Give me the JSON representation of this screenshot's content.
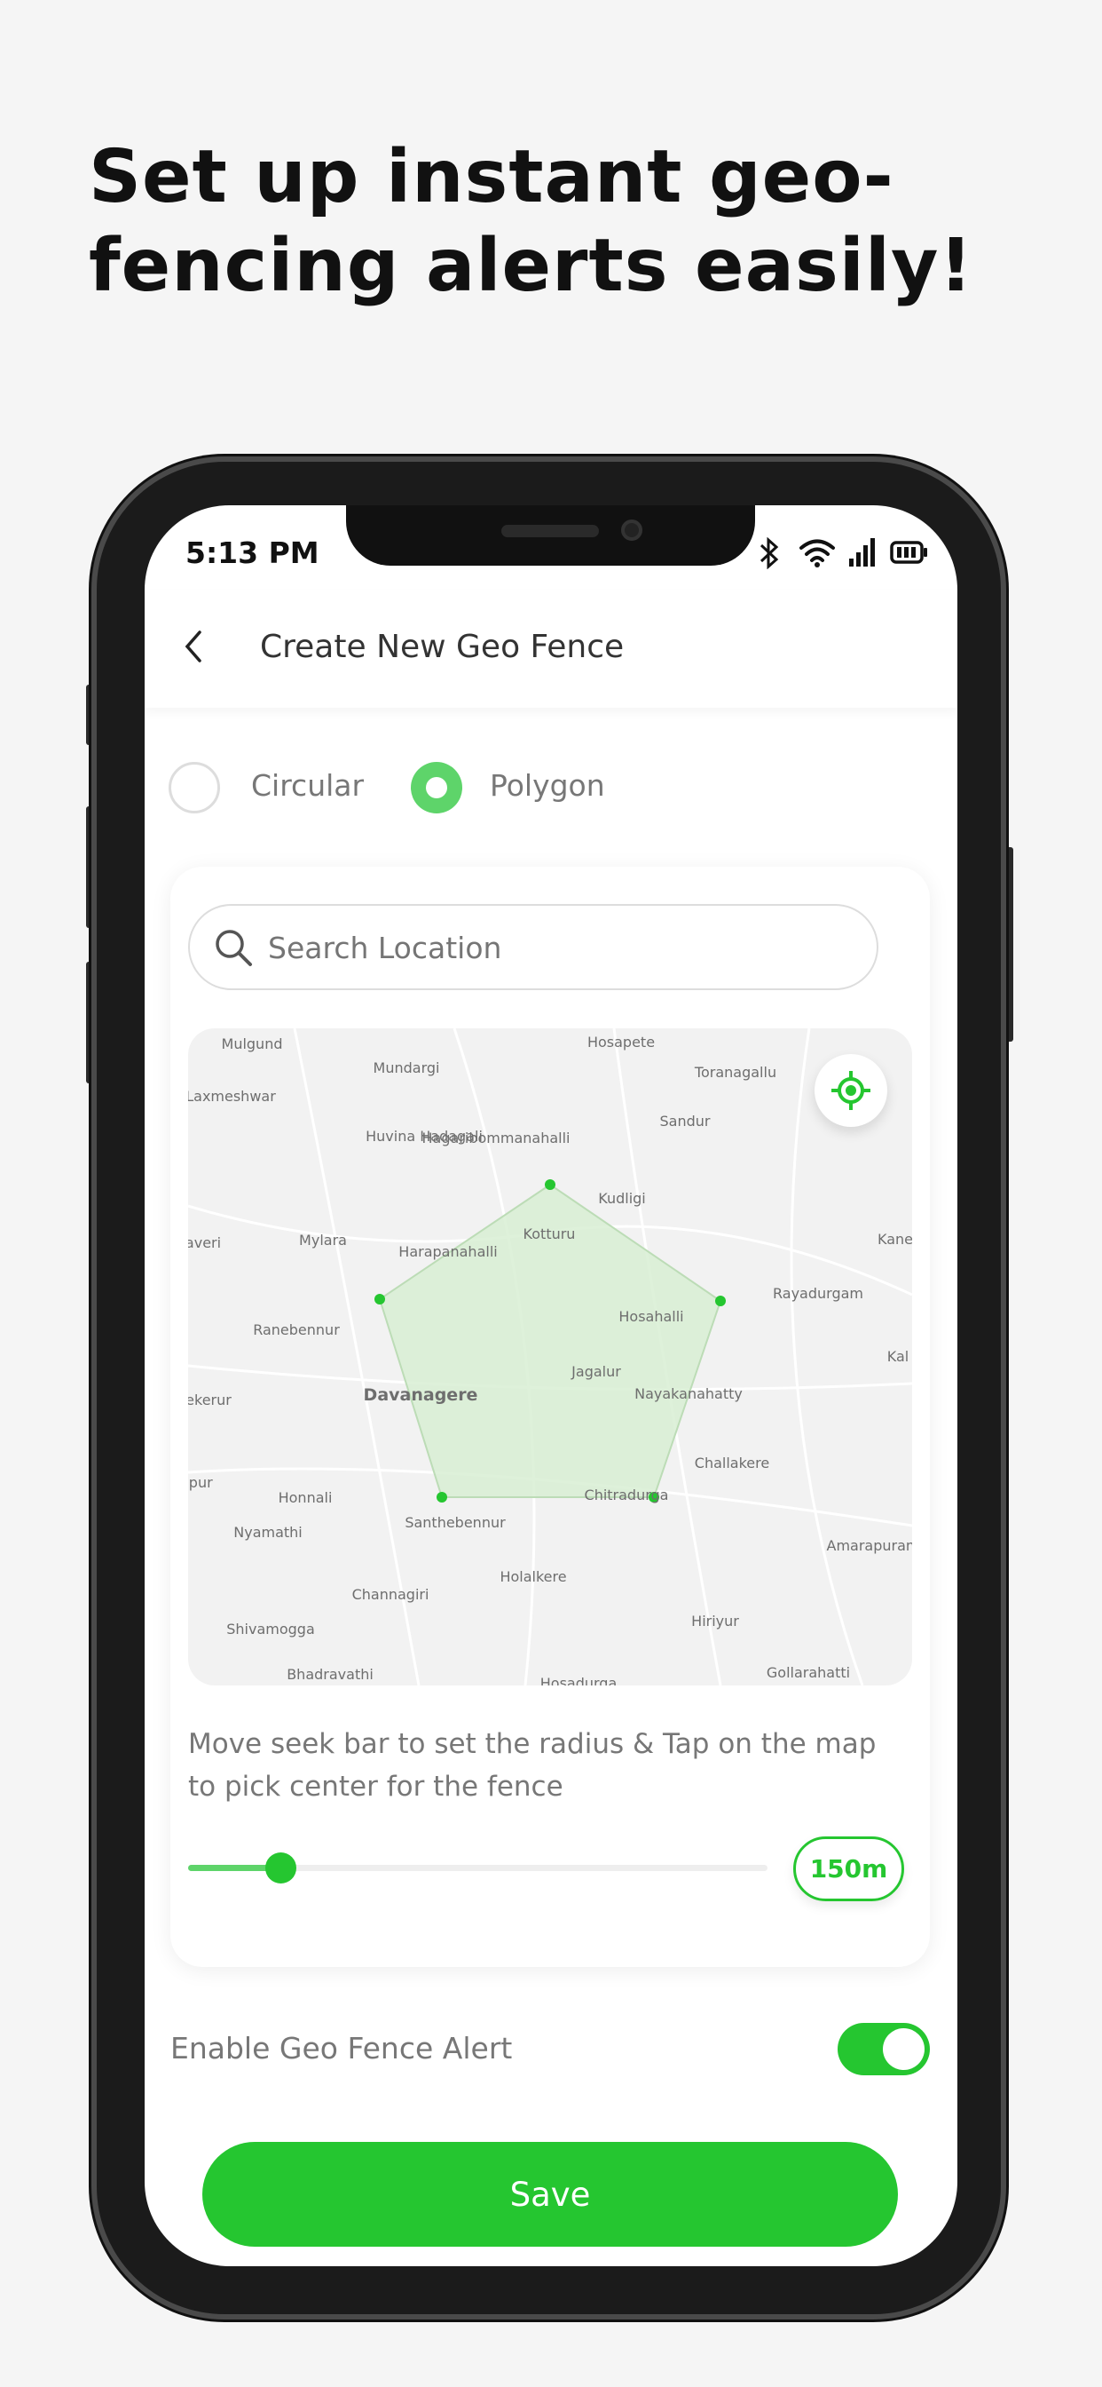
{
  "headline": "Set up instant geo-fencing alerts easily!",
  "status_bar": {
    "time": "5:13 PM",
    "icons": [
      "bluetooth-icon",
      "wifi-icon",
      "signal-icon",
      "battery-icon"
    ]
  },
  "header": {
    "title": "Create New Geo Fence",
    "back_icon": "chevron-left-icon"
  },
  "fence_type": {
    "options": [
      {
        "label": "Circular",
        "selected": false
      },
      {
        "label": "Polygon",
        "selected": true
      }
    ]
  },
  "search": {
    "placeholder": "Search Location",
    "value": ""
  },
  "map": {
    "labels": [
      "Mulgund",
      "Hosapete",
      "Mundargi",
      "Toranagallu",
      "Laxmeshwar",
      "Sandur",
      "Huvina Hadagali",
      "Hagaribommanahalli",
      "Kudligi",
      "Kotturu",
      "Kane",
      "averi",
      "Mylara",
      "Harapanahalli",
      "Rayadurgam",
      "Hosahalli",
      "Ranebennur",
      "Kal",
      "Jagalur",
      "Davanagere",
      "Nayakanahatty",
      "ekerur",
      "Challakere",
      "ipur",
      "Honnali",
      "Chitradurga",
      "Nyamathi",
      "Santhebennur",
      "Amarapuram",
      "Holalkere",
      "Channagiri",
      "Hiriyur",
      "Shivamogga",
      "Bhadravathi",
      "Hosadurga",
      "Gollarahatti"
    ],
    "polygon_vertex_count": 5,
    "locate_icon": "crosshair-location-icon"
  },
  "instruction": "Move seek bar to set the radius & Tap on the map to pick center for the fence",
  "radius": {
    "value_label": "150m",
    "slider_fraction": 0.16
  },
  "alert": {
    "label": "Enable Geo Fence Alert",
    "enabled": true
  },
  "save_label": "Save",
  "colors": {
    "accent": "#25c630",
    "polygon_fill": "#dcefd9"
  }
}
